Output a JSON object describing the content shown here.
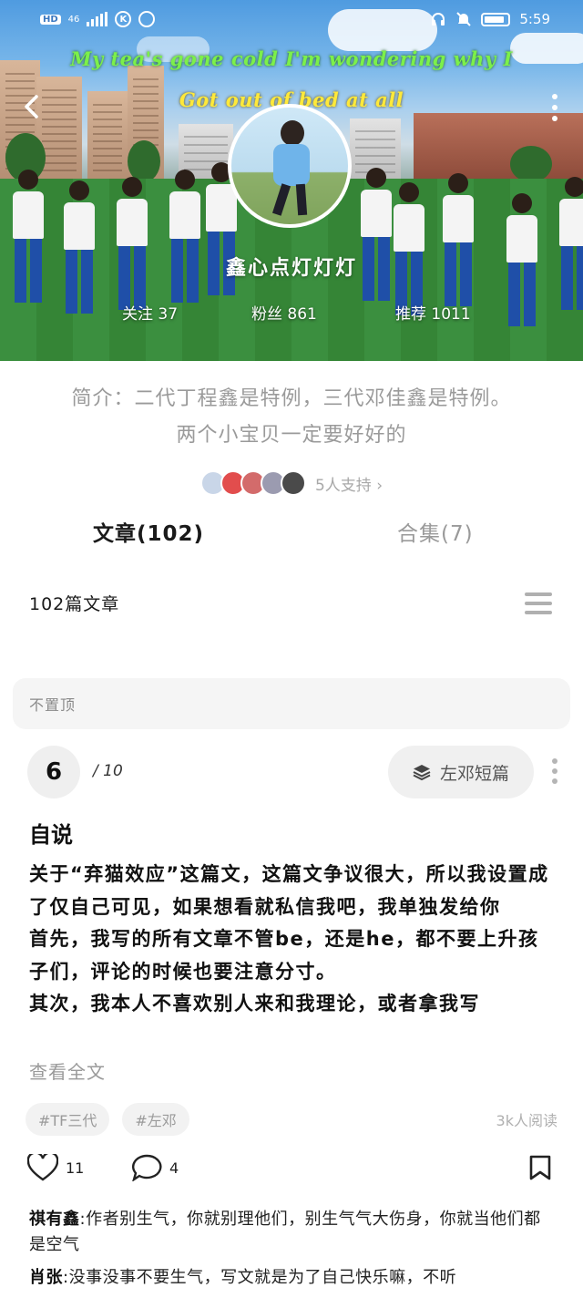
{
  "status_bar": {
    "network": "46",
    "time": "5:59",
    "icons": [
      "hd-icon",
      "signal-icon",
      "k-icon",
      "notification-icon",
      "headphones-icon",
      "mute-icon",
      "battery-icon"
    ]
  },
  "header": {
    "lyric_line1": "My tea's gone cold I'm wondering why I",
    "lyric_line2": "Got out of bed at all",
    "nickname": "鑫心点灯灯灯",
    "stats": {
      "following": "关注 37",
      "fans": "粉丝 861",
      "recommend": "推荐 1011"
    }
  },
  "profile": {
    "intro_line1": "简介：二代丁程鑫是特例，三代邓佳鑫是特例。",
    "intro_line2": "两个小宝贝一定要好好的",
    "supporters_text": "5人支持 ›"
  },
  "tabs": {
    "articles": "文章(102)",
    "collections": "合集(7)"
  },
  "list": {
    "count_label": "102篇文章",
    "pin_label": "不置顶"
  },
  "post": {
    "index": "6",
    "total": "/ 10",
    "collection_label": "左邓短篇",
    "title": "自说",
    "body_lines": [
      "关于“弃猫效应”这篇文，这篇文争议很大，所以我设置成了仅自己可见，如果想看就私信我吧，我单独发给你",
      "首先，我写的所有文章不管be，还是he，都不要上升孩子们，评论的时候也要注意分寸。",
      "其次，我本人不喜欢别人来和我理论，或者拿我写"
    ],
    "read_more": "查看全文",
    "tags": [
      "#TF三代",
      "#左邓"
    ],
    "reads": "3k人阅读",
    "likes": "11",
    "comments_count": "4"
  },
  "comments": [
    {
      "name": "祺有鑫",
      "text": "作者别生气，你就别理他们，别生气气大伤身，你就当他们都是空气"
    },
    {
      "name": "肖张",
      "text": "没事没事不要生气，写文就是为了自己快乐嘛，不听"
    }
  ],
  "colors": {
    "accent_text": "#1a1a1a",
    "muted_text": "#9a9a9a",
    "lyric1": "#7cf04a",
    "lyric2": "#ffe93a"
  }
}
